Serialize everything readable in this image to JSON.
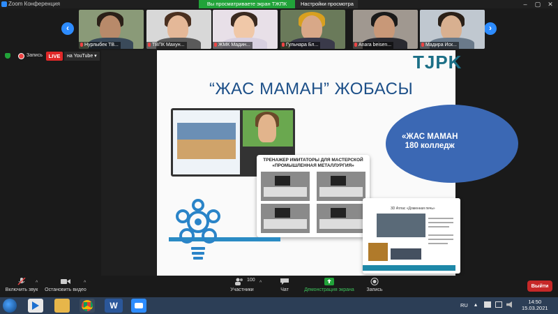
{
  "titlebar": {
    "title": "Zoom Конференция"
  },
  "share_banner": {
    "label": "Вы просматриваете экран ТЖПК"
  },
  "view_options": {
    "label": "Настройки просмотра"
  },
  "participants": [
    {
      "name": "Нурлыбек ТВ..."
    },
    {
      "name": "ТВПК  Махун..."
    },
    {
      "name": "ЖМК Мадин..."
    },
    {
      "name": "Гульнара Бл..."
    },
    {
      "name": "Anara beisen..."
    },
    {
      "name": "Мадира Иск..."
    }
  ],
  "status": {
    "record_label": "Запись",
    "live_label": "LIVE",
    "stream_label": "на YouTube"
  },
  "slide": {
    "logo": "TJPK",
    "title": "“ЖАС МАМАН” ЖОБАСЫ",
    "simulator_title": "ТРЕНАЖЕР ИМИТАТОРЫ ДЛЯ МАСТЕРСКОЙ «ПРОМЫШЛЕННАЯ МЕТАЛЛУРГИЯ»",
    "ellipse_line1": "«ЖАС МАМАН",
    "ellipse_line2": "180 колледж",
    "doc_heading": "3D Атлас «Доменная печь»"
  },
  "toolbar": {
    "unmute": "Включить звук",
    "stop_video": "Остановить видео",
    "participants_count": "100",
    "participants": "Участники",
    "chat": "Чат",
    "share_screen": "Демонстрация экрана",
    "record": "Запись",
    "leave": "Выйти"
  },
  "taskbar": {
    "lang": "RU",
    "time": "14:50",
    "date": "15.03.2021"
  },
  "colors": {
    "zoom_blue": "#2d8cff",
    "share_green": "#21a339",
    "live_red": "#e02828",
    "leave_red": "#c62828",
    "slide_title_blue": "#1c4f88"
  }
}
